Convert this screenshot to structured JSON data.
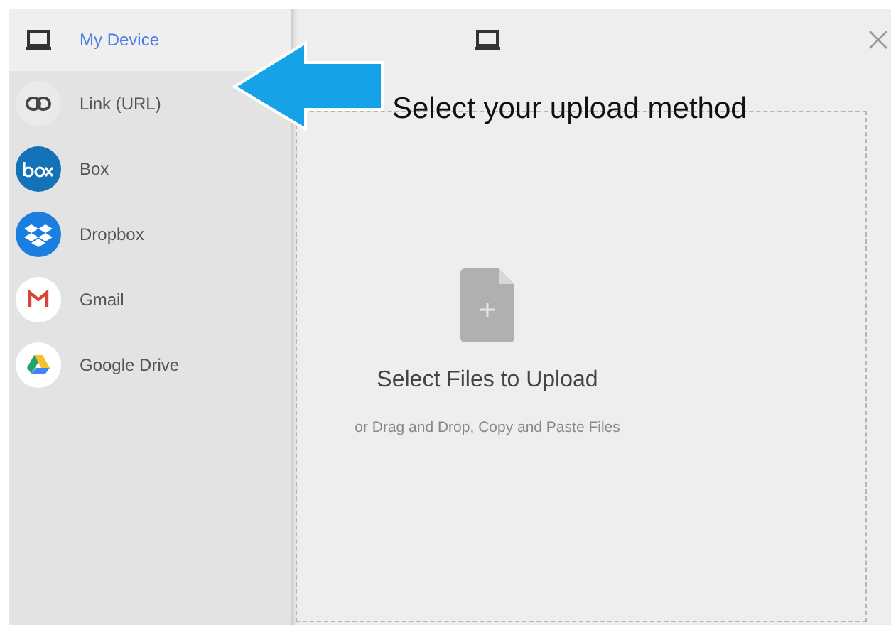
{
  "sidebar": {
    "items": [
      {
        "label": "My Device",
        "kind": "device",
        "selected": true
      },
      {
        "label": "Link (URL)",
        "kind": "link",
        "selected": false
      },
      {
        "label": "Box",
        "kind": "box",
        "selected": false
      },
      {
        "label": "Dropbox",
        "kind": "dropbox",
        "selected": false
      },
      {
        "label": "Gmail",
        "kind": "gmail",
        "selected": false
      },
      {
        "label": "Google Drive",
        "kind": "drive",
        "selected": false
      }
    ]
  },
  "annotation": {
    "text": "Select your upload method"
  },
  "drop_zone": {
    "title": "Select Files to Upload",
    "subtitle": "or Drag and Drop, Copy and Paste Files"
  }
}
